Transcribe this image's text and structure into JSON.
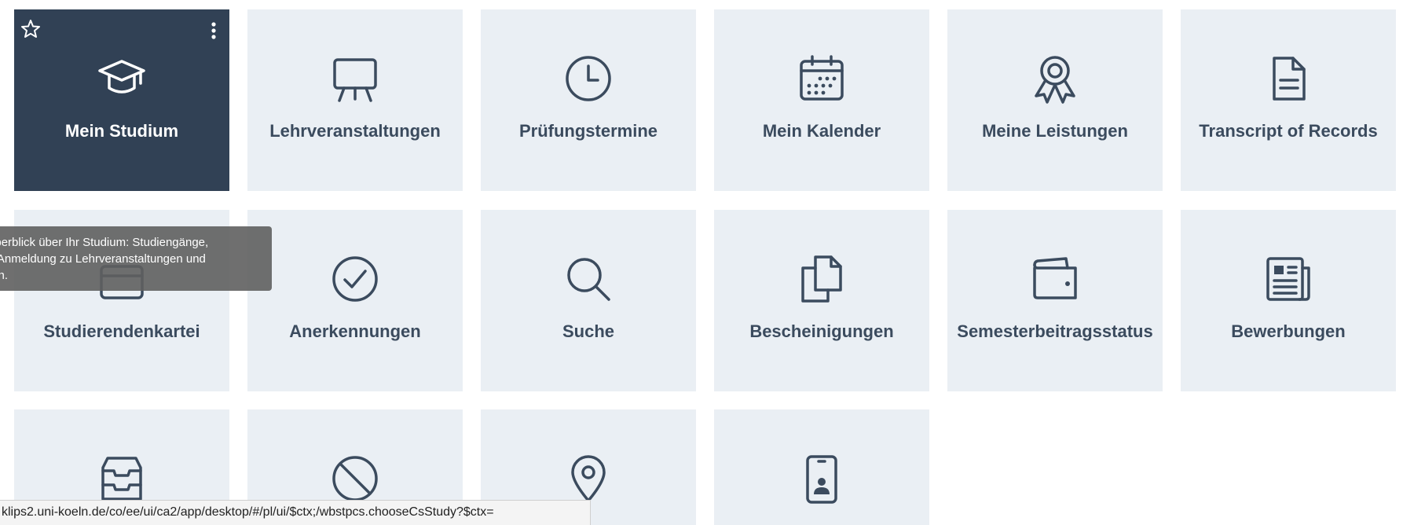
{
  "tiles": [
    {
      "label": "Mein Studium",
      "icon": "graduation-cap-icon",
      "active": true
    },
    {
      "label": "Lehrveranstaltungen",
      "icon": "presentation-board-icon"
    },
    {
      "label": "Prüfungstermine",
      "icon": "clock-icon"
    },
    {
      "label": "Mein Kalender",
      "icon": "calendar-icon"
    },
    {
      "label": "Meine Leistungen",
      "icon": "award-ribbon-icon"
    },
    {
      "label": "Transcript of Records",
      "icon": "document-icon"
    },
    {
      "label": "Studierendenkartei",
      "icon": "folder-icon"
    },
    {
      "label": "Anerkennungen",
      "icon": "check-circle-icon"
    },
    {
      "label": "Suche",
      "icon": "search-icon"
    },
    {
      "label": "Bescheinigungen",
      "icon": "copy-documents-icon"
    },
    {
      "label": "Semesterbeitragsstatus",
      "icon": "wallet-icon"
    },
    {
      "label": "Bewerbungen",
      "icon": "newspaper-icon"
    },
    {
      "label": "",
      "icon": "inbox-tray-icon"
    },
    {
      "label": "",
      "icon": "prohibited-icon"
    },
    {
      "label": "",
      "icon": "map-pin-icon"
    },
    {
      "label": "",
      "icon": "mobile-id-icon"
    }
  ],
  "active_tile_controls": {
    "favorite_icon": "star-icon",
    "menu_icon": "kebab-menu-icon"
  },
  "tooltip": {
    "text": "amtüberblick über Ihr Studium: Studiengänge,\ndule, Anmeldung zu Lehrveranstaltungen und\nfungen."
  },
  "statusbar": {
    "url": "klips2.uni-koeln.de/co/ee/ui/ca2/app/desktop/#/pl/ui/$ctx;/wbstpcs.chooseCsStudy?$ctx="
  },
  "colors": {
    "tile_bg": "#eaeff4",
    "active_tile_bg": "#314155",
    "text_dark": "#3b4b5e"
  }
}
